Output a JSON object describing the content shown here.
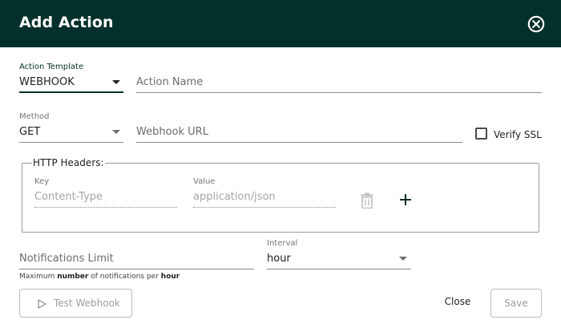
{
  "dialog": {
    "title": "Add Action",
    "close_icon": "close-circle-icon"
  },
  "action_template": {
    "label": "Action Template",
    "value": "WEBHOOK",
    "icon": "caret-down-icon"
  },
  "action_name": {
    "placeholder": "Action Name"
  },
  "method": {
    "label": "Method",
    "value": "GET",
    "icon": "caret-down-icon"
  },
  "webhook_url": {
    "placeholder": "Webhook URL"
  },
  "verify_ssl": {
    "label": "Verify SSL",
    "checked": false
  },
  "http_headers": {
    "legend": "HTTP Headers:",
    "key_label": "Key",
    "key_placeholder": "Content-Type",
    "value_label": "Value",
    "value_placeholder": "application/json",
    "delete_icon": "trash-icon",
    "add_icon": "plus-icon"
  },
  "notifications_limit": {
    "placeholder": "Notifications Limit",
    "hint_parts": [
      "Maximum ",
      "number",
      " of notifications per ",
      "hour"
    ]
  },
  "interval": {
    "label": "Interval",
    "value": "hour",
    "icon": "caret-down-icon"
  },
  "footer": {
    "test_label": "Test Webhook",
    "test_icon": "play-icon",
    "close_label": "Close",
    "save_label": "Save"
  },
  "colors": {
    "header_bg": "#03302a",
    "header_text": "#ffffff",
    "disabled_text": "#9e9e9e"
  }
}
